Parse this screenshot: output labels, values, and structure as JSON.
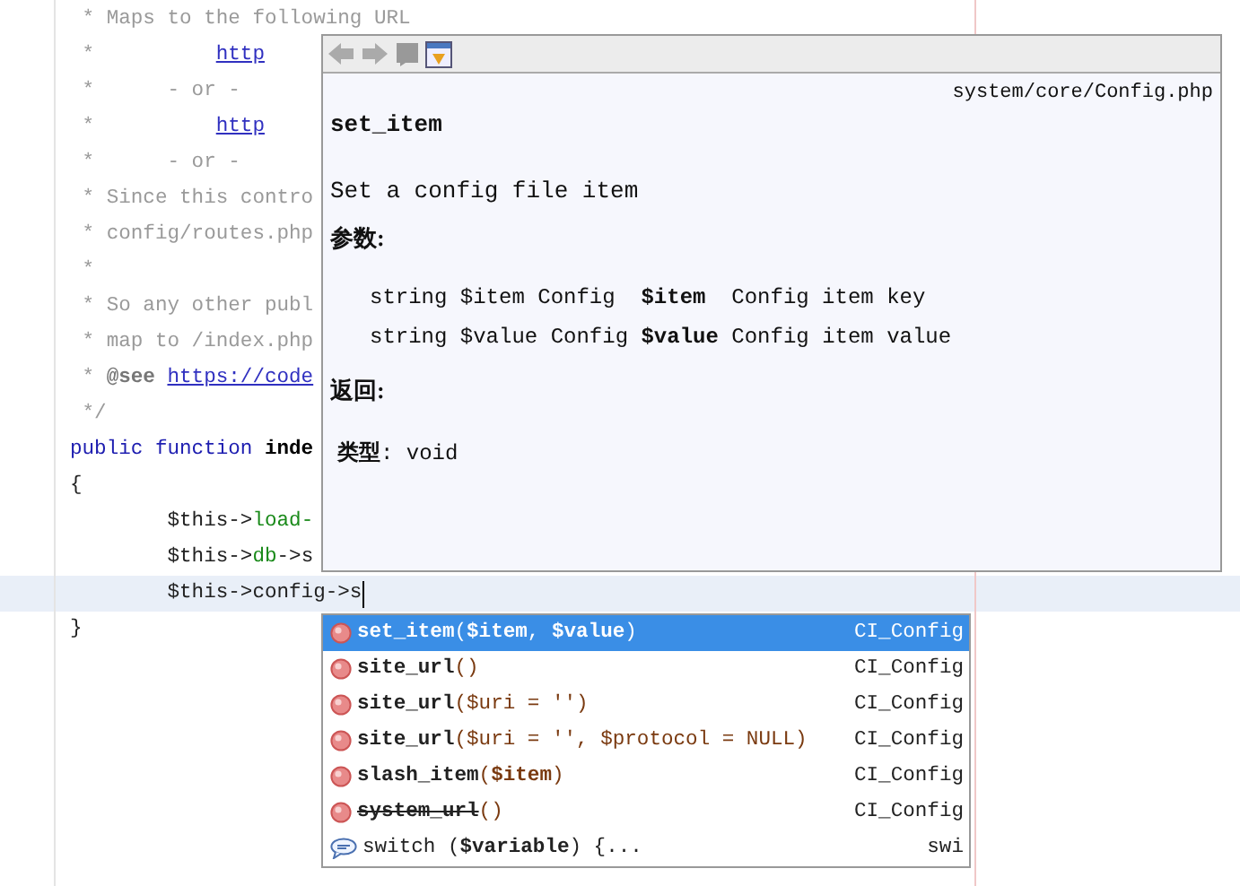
{
  "editor": {
    "lines": [
      {
        "segments": [
          {
            "kind": "comment",
            "text": " * Maps to the following URL"
          }
        ]
      },
      {
        "segments": [
          {
            "kind": "comment",
            "text": " *          "
          },
          {
            "kind": "link",
            "text": "http"
          }
        ]
      },
      {
        "segments": [
          {
            "kind": "comment",
            "text": " *      - or -"
          }
        ]
      },
      {
        "segments": [
          {
            "kind": "comment",
            "text": " *          "
          },
          {
            "kind": "link",
            "text": "http"
          }
        ]
      },
      {
        "segments": [
          {
            "kind": "comment",
            "text": " *      - or -"
          }
        ]
      },
      {
        "segments": [
          {
            "kind": "comment",
            "text": " * Since this contro"
          }
        ]
      },
      {
        "segments": [
          {
            "kind": "comment",
            "text": " * config/routes.php"
          }
        ]
      },
      {
        "segments": [
          {
            "kind": "comment",
            "text": " *"
          }
        ]
      },
      {
        "segments": [
          {
            "kind": "comment",
            "text": " * So any other publ"
          }
        ]
      },
      {
        "segments": [
          {
            "kind": "comment",
            "text": " * map to /index.php"
          }
        ]
      },
      {
        "segments": [
          {
            "kind": "comment",
            "text": " * "
          },
          {
            "kind": "tag",
            "text": "@see"
          },
          {
            "kind": "link",
            "text": "https://code"
          }
        ]
      },
      {
        "segments": [
          {
            "kind": "comment",
            "text": " */"
          }
        ]
      },
      {
        "segments": [
          {
            "kind": "keyword",
            "text": "public function "
          },
          {
            "kind": "name",
            "text": "inde"
          }
        ]
      },
      {
        "segments": [
          {
            "kind": "plain",
            "text": "{"
          }
        ]
      },
      {
        "segments": [
          {
            "kind": "plain",
            "text": "        $this->"
          },
          {
            "kind": "member",
            "text": "load-"
          }
        ]
      },
      {
        "segments": [
          {
            "kind": "plain",
            "text": "        $this->"
          },
          {
            "kind": "member",
            "text": "db"
          },
          {
            "kind": "plain",
            "text": "->s"
          }
        ]
      },
      {
        "current": true,
        "segments": [
          {
            "kind": "plain",
            "text": "        $this->config->s"
          }
        ]
      },
      {
        "segments": [
          {
            "kind": "plain",
            "text": "}"
          }
        ]
      }
    ]
  },
  "doc_popup": {
    "file": "system/core/Config.php",
    "title": "set_item",
    "description": "Set a config file item",
    "params_heading": "参数:",
    "params": [
      "string $item Config  **$item**  Config item key",
      "string $value Config **$value** Config item value"
    ],
    "returns_heading": "返回:",
    "returns": "**类型**: void"
  },
  "completion": {
    "items": [
      {
        "kind": "method",
        "name": "set_item",
        "params": "(**$item**, **$value**)",
        "type": "CI_Config",
        "selected": true,
        "deprecated": false
      },
      {
        "kind": "method",
        "name": "site_url",
        "params": "()",
        "type": "CI_Config",
        "selected": false,
        "deprecated": false
      },
      {
        "kind": "method",
        "name": "site_url",
        "params": "($uri = '')",
        "type": "CI_Config",
        "selected": false,
        "deprecated": false
      },
      {
        "kind": "method",
        "name": "site_url",
        "params": "($uri = '', $protocol = NULL)",
        "type": "CI_Config",
        "selected": false,
        "deprecated": false
      },
      {
        "kind": "method",
        "name": "slash_item",
        "params": "(**$item**)",
        "type": "CI_Config",
        "selected": false,
        "deprecated": false
      },
      {
        "kind": "method",
        "name": "system_url",
        "params": "()",
        "type": "CI_Config",
        "selected": false,
        "deprecated": true
      },
      {
        "kind": "template",
        "name": "switch (**$variable**) {...",
        "type": "swi",
        "selected": false,
        "deprecated": false
      }
    ]
  }
}
